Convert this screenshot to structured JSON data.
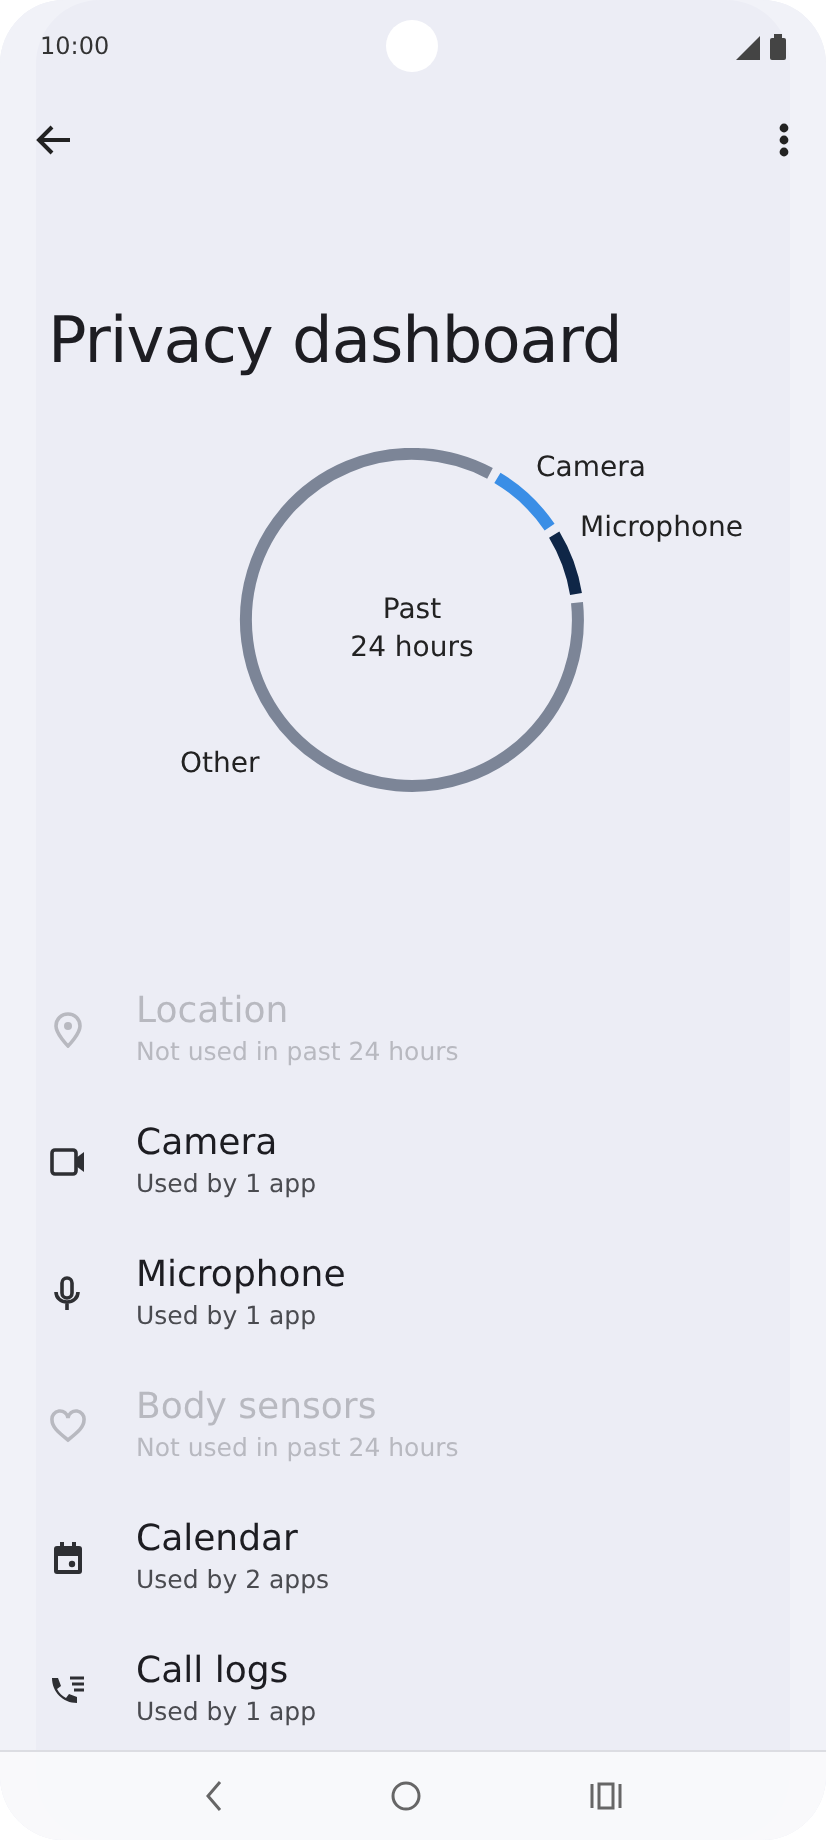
{
  "status_bar": {
    "time": "10:00"
  },
  "title": "Privacy dashboard",
  "usage_ring": {
    "center_lines": [
      "Past",
      "24 hours"
    ],
    "segments": [
      {
        "label": "Camera",
        "color": "#3a8ee6"
      },
      {
        "label": "Microphone",
        "color": "#0f2647"
      },
      {
        "label": "Other",
        "color": "#7c8597"
      }
    ]
  },
  "permissions": [
    {
      "kind": "location",
      "name": "Location",
      "detail": "Not used in past 24 hours",
      "disabled": true
    },
    {
      "kind": "camera",
      "name": "Camera",
      "detail": "Used by 1 app",
      "disabled": false
    },
    {
      "kind": "microphone",
      "name": "Microphone",
      "detail": "Used by 1 app",
      "disabled": false
    },
    {
      "kind": "body_sensors",
      "name": "Body sensors",
      "detail": "Not used in past 24 hours",
      "disabled": true
    },
    {
      "kind": "calendar",
      "name": "Calendar",
      "detail": "Used by 2 apps",
      "disabled": false
    },
    {
      "kind": "call_logs",
      "name": "Call logs",
      "detail": "Used by 1 app",
      "disabled": false
    }
  ]
}
